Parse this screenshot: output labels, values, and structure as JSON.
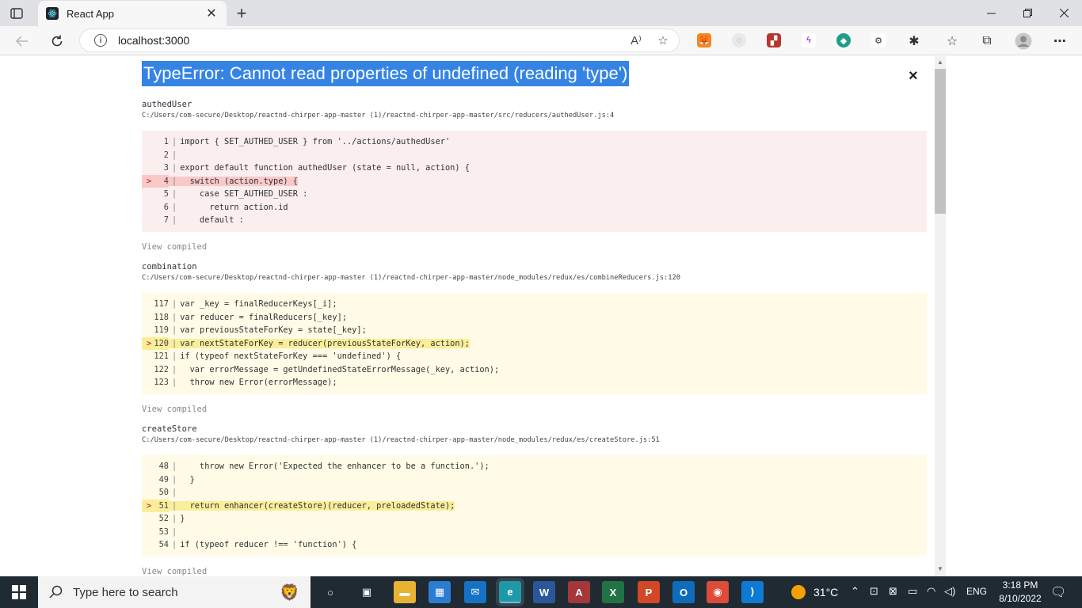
{
  "browser": {
    "tab_title": "React App",
    "tab_close": "✕",
    "new_tab": "+",
    "url": "localhost:3000",
    "accent": "#3584e4"
  },
  "error": {
    "title": "TypeError: Cannot read properties of undefined (reading 'type')",
    "close": "×"
  },
  "frames": [
    {
      "function": "authedUser",
      "path": "C:/Users/com-secure/Desktop/reactnd-chirper-app-master (1)/reactnd-chirper-app-master/src/reducers/authedUser.js:4",
      "theme": "red",
      "lines": [
        {
          "num": "1",
          "text": "import { SET_AUTHED_USER } from '../actions/authedUser'",
          "hl": false
        },
        {
          "num": "2",
          "text": "",
          "hl": false
        },
        {
          "num": "3",
          "text": "export default function authedUser (state = null, action) {",
          "hl": false
        },
        {
          "num": "4",
          "text": "  switch (action.type) {",
          "hl": true
        },
        {
          "num": "5",
          "text": "    case SET_AUTHED_USER :",
          "hl": false
        },
        {
          "num": "6",
          "text": "      return action.id",
          "hl": false
        },
        {
          "num": "7",
          "text": "    default :",
          "hl": false
        }
      ],
      "view_compiled": "View compiled"
    },
    {
      "function": "combination",
      "path": "C:/Users/com-secure/Desktop/reactnd-chirper-app-master (1)/reactnd-chirper-app-master/node_modules/redux/es/combineReducers.js:120",
      "theme": "yellow",
      "lines": [
        {
          "num": "117",
          "text": "var _key = finalReducerKeys[_i];",
          "hl": false
        },
        {
          "num": "118",
          "text": "var reducer = finalReducers[_key];",
          "hl": false
        },
        {
          "num": "119",
          "text": "var previousStateForKey = state[_key];",
          "hl": false
        },
        {
          "num": "120",
          "text": "var nextStateForKey = reducer(previousStateForKey, action);",
          "hl": true
        },
        {
          "num": "121",
          "text": "if (typeof nextStateForKey === 'undefined') {",
          "hl": false
        },
        {
          "num": "122",
          "text": "  var errorMessage = getUndefinedStateErrorMessage(_key, action);",
          "hl": false
        },
        {
          "num": "123",
          "text": "  throw new Error(errorMessage);",
          "hl": false
        }
      ],
      "view_compiled": "View compiled"
    },
    {
      "function": "createStore",
      "path": "C:/Users/com-secure/Desktop/reactnd-chirper-app-master (1)/reactnd-chirper-app-master/node_modules/redux/es/createStore.js:51",
      "theme": "yellow",
      "lines": [
        {
          "num": "48",
          "text": "    throw new Error('Expected the enhancer to be a function.');",
          "hl": false
        },
        {
          "num": "49",
          "text": "  }",
          "hl": false
        },
        {
          "num": "50",
          "text": "",
          "hl": false
        },
        {
          "num": "51",
          "text": "  return enhancer(createStore)(reducer, preloadedState);",
          "hl": true
        },
        {
          "num": "52",
          "text": "}",
          "hl": false
        },
        {
          "num": "53",
          "text": "",
          "hl": false
        },
        {
          "num": "54",
          "text": "if (typeof reducer !== 'function') {",
          "hl": false
        }
      ],
      "view_compiled": "View compiled"
    }
  ],
  "taskbar": {
    "search_placeholder": "Type here to search",
    "temperature": "31°C",
    "language": "ENG",
    "time": "3:18 PM",
    "date": "8/10/2022",
    "apps": [
      {
        "name": "cortana",
        "glyph": "○",
        "color": "transparent"
      },
      {
        "name": "task-view",
        "glyph": "▣",
        "color": "transparent"
      },
      {
        "name": "file-explorer",
        "glyph": "▬",
        "color": "#e8b232"
      },
      {
        "name": "microsoft-store",
        "glyph": "▦",
        "color": "#2b7cd3"
      },
      {
        "name": "mail",
        "glyph": "✉",
        "color": "#1572c4"
      },
      {
        "name": "edge",
        "glyph": "e",
        "color": "#1c9aa8"
      },
      {
        "name": "word",
        "glyph": "W",
        "color": "#2b579a"
      },
      {
        "name": "access",
        "glyph": "A",
        "color": "#a4373a"
      },
      {
        "name": "excel",
        "glyph": "X",
        "color": "#217346"
      },
      {
        "name": "powerpoint",
        "glyph": "P",
        "color": "#d24726"
      },
      {
        "name": "outlook",
        "glyph": "O",
        "color": "#0f6cbd"
      },
      {
        "name": "chrome",
        "glyph": "◉",
        "color": "#dd4b39"
      },
      {
        "name": "vscode",
        "glyph": "⟩",
        "color": "#0e7ad4"
      }
    ]
  }
}
